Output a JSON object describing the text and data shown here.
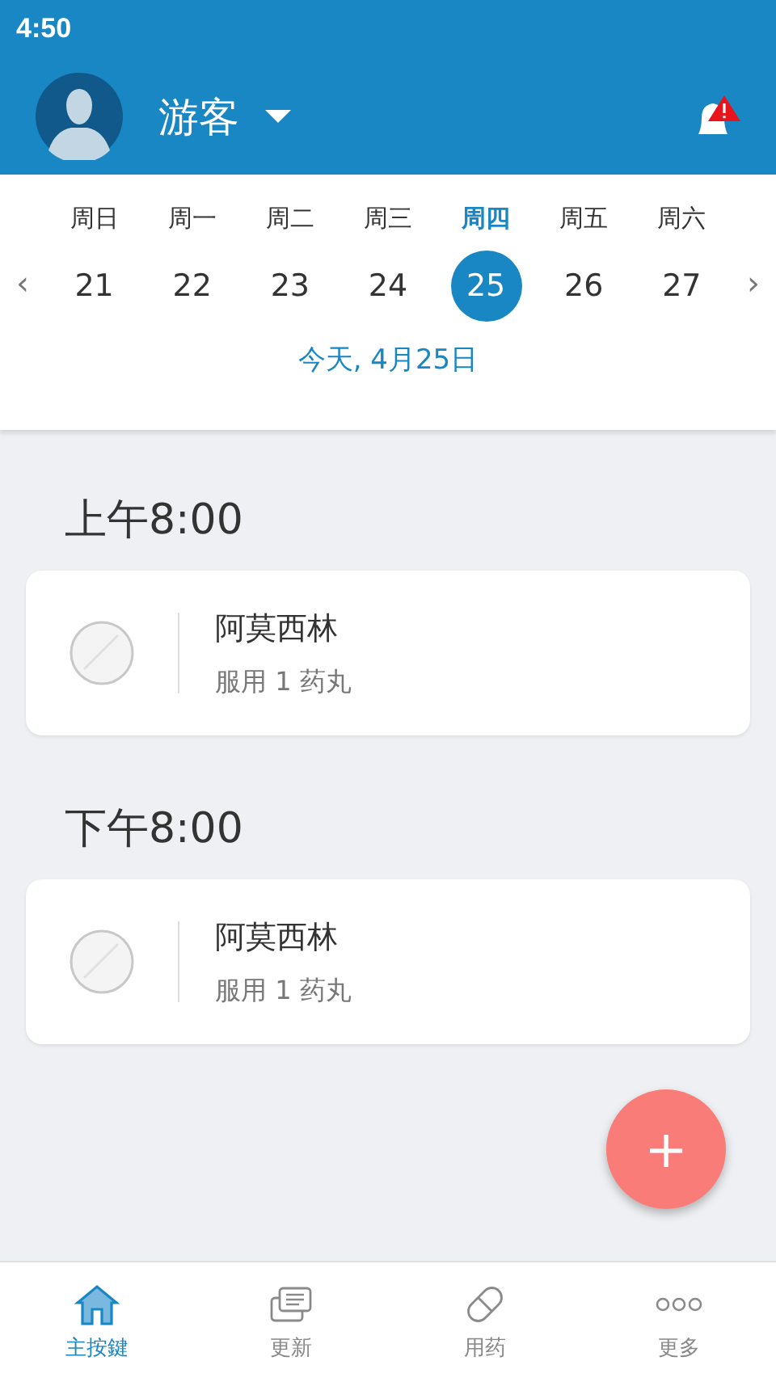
{
  "status_bar": {
    "time": "4:50"
  },
  "header": {
    "user_name": "游客",
    "alert": true
  },
  "calendar": {
    "prev": "‹",
    "next": "›",
    "today_label": "今天, 4月25日",
    "days": [
      {
        "weekday": "周日",
        "date": "21",
        "selected": false
      },
      {
        "weekday": "周一",
        "date": "22",
        "selected": false
      },
      {
        "weekday": "周二",
        "date": "23",
        "selected": false
      },
      {
        "weekday": "周三",
        "date": "24",
        "selected": false
      },
      {
        "weekday": "周四",
        "date": "25",
        "selected": true
      },
      {
        "weekday": "周五",
        "date": "26",
        "selected": false
      },
      {
        "weekday": "周六",
        "date": "27",
        "selected": false
      }
    ]
  },
  "schedule": [
    {
      "time": "上午8:00",
      "doses": [
        {
          "name": "阿莫西林",
          "instruction": "服用 1 药丸"
        }
      ]
    },
    {
      "time": "下午8:00",
      "doses": [
        {
          "name": "阿莫西林",
          "instruction": "服用 1 药丸"
        }
      ]
    }
  ],
  "fab": {
    "label": "+"
  },
  "bottom_nav": [
    {
      "kind": "home",
      "label": "主按鍵",
      "selected": true
    },
    {
      "kind": "updates",
      "label": "更新",
      "selected": false
    },
    {
      "kind": "medication",
      "label": "用药",
      "selected": false
    },
    {
      "kind": "more",
      "label": "更多",
      "selected": false
    }
  ]
}
